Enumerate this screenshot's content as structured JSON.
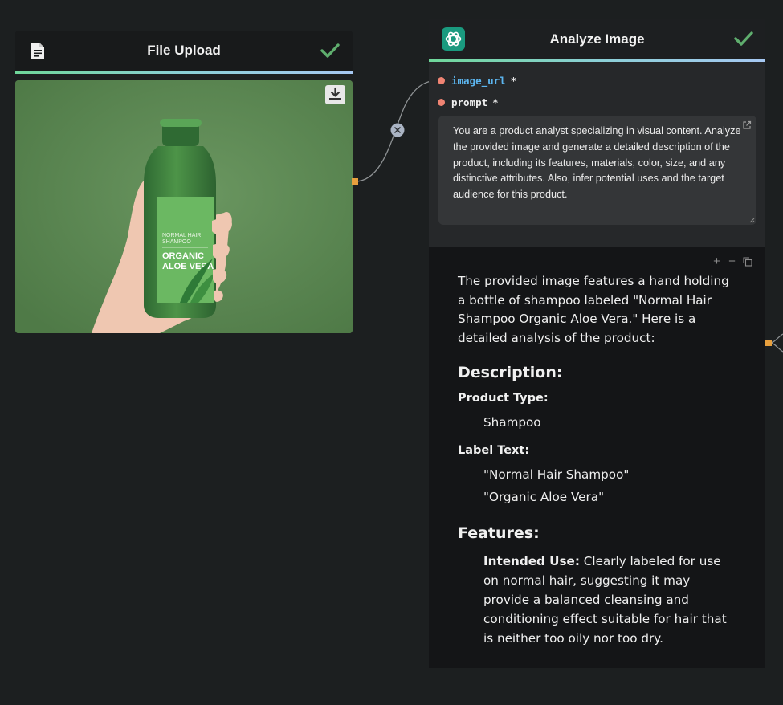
{
  "file_upload": {
    "title": "File Upload",
    "status": "success",
    "image_label": {
      "line1": "NORMAL HAIR",
      "line2": "SHAMPOO",
      "line3": "ORGANIC",
      "line4": "ALOE VERA"
    }
  },
  "analyze": {
    "title": "Analyze Image",
    "status": "success",
    "inputs": [
      {
        "name": "image_url",
        "required": "*"
      },
      {
        "name": "prompt",
        "required": "*"
      }
    ],
    "prompt_text": "You are a product analyst specializing in visual content. Analyze the provided image and generate a detailed description of the product, including its features, materials, color, size, and any distinctive attributes. Also, infer potential uses and the target audience for this product.",
    "output": {
      "toolbar": [
        "+",
        "−",
        "copy"
      ],
      "lead": "The provided image features a hand holding a bottle of shampoo labeled \"Normal Hair Shampoo Organic Aloe Vera.\" Here is a detailed analysis of the product:",
      "h_description": "Description:",
      "product_type_label": "Product Type:",
      "product_type_value": "Shampoo",
      "label_text_label": "Label Text:",
      "label_text_values": [
        "\"Normal Hair Shampoo\"",
        "\"Organic Aloe Vera\""
      ],
      "h_features": "Features:",
      "intended_use_label": "Intended Use:",
      "intended_use_text": " Clearly labeled for use on normal hair, suggesting it may provide a balanced cleansing and conditioning effect suitable for hair that is neither too oily nor too dry."
    }
  },
  "colors": {
    "background": "#1c1f20",
    "accent_gradient": [
      "#6fd79a",
      "#a6c8f2"
    ],
    "port_input": "#f08473",
    "port_output": "#e7a03e",
    "check": "#5fae6e",
    "var_blue": "#5cb6f0"
  }
}
